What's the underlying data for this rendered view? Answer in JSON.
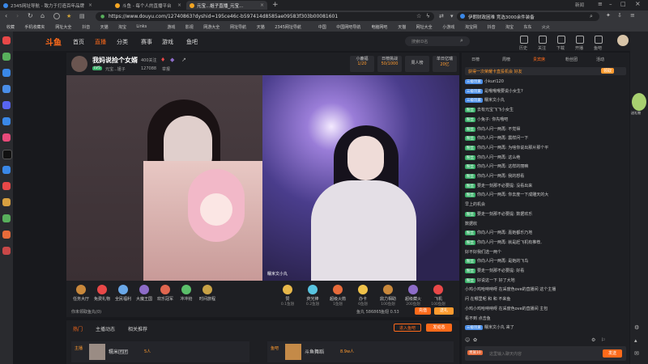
{
  "browser": {
    "tabs": [
      {
        "title": "2345网址导航 - 致力于打造百年品牌",
        "color": "#3a88e8"
      },
      {
        "title": "斗鱼 - 每个人的直播平台",
        "color": "#f5a623"
      },
      {
        "title": "元宝...姐子直播_元宝...",
        "color": "#f5a623"
      }
    ],
    "window_label": "新闻",
    "url": "https://www.douyu.com/12740863?dyshid=195ce46c-b597414d8585ae09583f303b00081601",
    "side_search_text": "伊朗财政困难 竞选3000余件装备",
    "bookmarks": [
      "收藏",
      "手机收藏夹",
      "网址大全",
      "抖音",
      "天猫",
      "淘宝",
      "Links",
      "游戏",
      "影视",
      "网游大全",
      "网址导航",
      "天猫",
      "2345网址导航",
      "中国",
      "中国网吧导航",
      "电脑网吧",
      "天猫",
      "网址大全",
      "小游戏",
      "淘宝网",
      "抖音",
      "淘宝",
      "东东",
      "火火"
    ]
  },
  "site": {
    "logo": "斗鱼",
    "nav": [
      "首页",
      "直播",
      "分类",
      "赛事",
      "游戏",
      "鱼吧"
    ],
    "search_placeholder": "搜索ID名",
    "header_icons": [
      "历史",
      "关注",
      "下载",
      "开播",
      "鱼吧"
    ]
  },
  "room": {
    "title": "我妈说捡个女婿",
    "follows": "400关注",
    "streamer": "元宝...姐子",
    "level": "LV5",
    "room_id": "127088",
    "report": "举报",
    "stats": [
      {
        "label": "小鹿福",
        "value": "1/20"
      },
      {
        "label": "日榜挑战",
        "value": "50/1000"
      },
      {
        "label": "周人榜",
        "value": ""
      },
      {
        "label": "单日亿瑞",
        "value": "20亿"
      }
    ],
    "watermark": "糯米文小丸"
  },
  "gifts_left": [
    {
      "label": "任务大厅",
      "color": "#c9883b"
    },
    {
      "label": "免费礼物",
      "color": "#e94848"
    },
    {
      "label": "全民福利",
      "color": "#6aa8e8"
    },
    {
      "label": "大魔王国",
      "color": "#8d6cc8"
    },
    {
      "label": "欢乐冠军",
      "color": "#e0664f"
    },
    {
      "label": "冲冲抢",
      "color": "#5bbf6a"
    },
    {
      "label": "时间旅程",
      "color": "#c9a246"
    }
  ],
  "gifts_right": [
    {
      "label": "赞",
      "sub": "0.1鱼翅",
      "color": "#e8b84a"
    },
    {
      "label": "荧光棒",
      "sub": "0.2鱼翅",
      "color": "#58c4e0"
    },
    {
      "label": "超级火箭",
      "sub": "1鱼翅",
      "color": "#e86b3a"
    },
    {
      "label": "办卡",
      "sub": "6鱼翅",
      "color": "#f0c24a"
    },
    {
      "label": "鼎力相助",
      "sub": "100鱼翅",
      "color": "#c9883b"
    },
    {
      "label": "超级藏火",
      "sub": "200鱼翅",
      "color": "#8d6cc8"
    },
    {
      "label": "飞机",
      "sub": "100鱼翅",
      "color": "#e94848"
    }
  ],
  "user_bar": {
    "notice": "你未领取鱼丸(0)",
    "fish_balls": "鱼丸 586865",
    "fish_fins": "鱼翅 0.53",
    "btn_recharge": "充值",
    "btn_gift": "送礼"
  },
  "bottom": {
    "tabs": [
      "热门",
      "主播动态",
      "相关推荐"
    ],
    "btn_enter": "进入鱼吧",
    "btn_post": "发动态",
    "cards": [
      {
        "tag": "主播",
        "name": "糯米团团",
        "count": "5人"
      },
      {
        "tag": "鱼吧",
        "name": "斗鱼舞蹈",
        "count": "8.9w人"
      }
    ]
  },
  "chat": {
    "tabs": [
      "日榜",
      "周榜",
      "贵宾席",
      "粉丝团",
      "活动"
    ],
    "banner": "获得一次荣耀卡直投机会 好友",
    "banner_btn": "领取",
    "messages": [
      {
        "badge": "三级玩家",
        "badge_color": "#4a8ee8",
        "text": "小kuri120"
      },
      {
        "badge": "三级玩家",
        "badge_color": "#4a8ee8",
        "text": "是哦哦哦要说小女生?"
      },
      {
        "badge": "三级玩家",
        "badge_color": "#4a8ee8",
        "text": "糯米文小丸"
      },
      {
        "badge": "粉丝",
        "badge_color": "#3ab26a",
        "text": "去有元宝飞飞小女生"
      },
      {
        "badge": "粉丝",
        "badge_color": "#3ab26a",
        "text": "小兔子: 你先哦吧"
      },
      {
        "badge": "粉丝",
        "badge_color": "#3ab26a",
        "text": "你向人问一两再: 不觉得"
      },
      {
        "badge": "粉丝",
        "badge_color": "#3ab26a",
        "text": "你向人问一两再: 震样问一下"
      },
      {
        "badge": "粉丝",
        "badge_color": "#3ab26a",
        "text": "你向人问一两再: 为啥你说出那片那个平"
      },
      {
        "badge": "粉丝",
        "badge_color": "#3ab26a",
        "text": "你向人问一两再: 这么绝"
      },
      {
        "badge": "粉丝",
        "badge_color": "#3ab26a",
        "text": "你向人问一两再: 这样的丽嘛"
      },
      {
        "badge": "粉丝",
        "badge_color": "#3ab26a",
        "text": "你向人问一两再: 我的想看"
      },
      {
        "badge": "粉丝",
        "badge_color": "#3ab26a",
        "text": "要走一刻那不必要提: 没看出来"
      },
      {
        "badge": "粉丝",
        "badge_color": "#3ab26a",
        "text": "你向人问一两再: 你去度一下成雕天的大"
      },
      {
        "badge": "",
        "badge_color": "",
        "text": "早上的机会"
      },
      {
        "badge": "粉丝",
        "badge_color": "#3ab26a",
        "text": "要走一刻那不必要提: 数据欢乐"
      },
      {
        "badge": "",
        "badge_color": "",
        "text": "数据收"
      },
      {
        "badge": "粉丝",
        "badge_color": "#3ab26a",
        "text": "你向人问一两再: 嘉她都乐乃地"
      },
      {
        "badge": "粉丝",
        "badge_color": "#3ab26a",
        "text": "你向人问一两再: 就是赶飞机有推荐,"
      },
      {
        "badge": "",
        "badge_color": "",
        "text": "好不好我们选一两个"
      },
      {
        "badge": "粉丝",
        "badge_color": "#3ab26a",
        "text": "你向人问一两再: 是她的飞鸟"
      },
      {
        "badge": "粉丝",
        "badge_color": "#3ab26a",
        "text": "要走一刻那不必要提: 好看"
      },
      {
        "badge": "粉丝",
        "badge_color": "#3ab26a",
        "text": "好说这一下 好了大地"
      },
      {
        "badge": "",
        "badge_color": "",
        "text": "小鸡小鸡哈呐呐呀 在采度色ove的直播间 这个主播"
      },
      {
        "badge": "",
        "badge_color": "",
        "text": "问 在哪里呢 和 和 不来鱼"
      },
      {
        "badge": "",
        "badge_color": "",
        "text": "小鸡小鸡哈呐呐呀 在采度色ove的直播间 主包"
      },
      {
        "badge": "",
        "badge_color": "",
        "text": "看不到 点击鱼"
      },
      {
        "badge": "三级玩家",
        "badge_color": "#4a8ee8",
        "text": "糯米文小丸 来了"
      }
    ],
    "input_placeholder": "这里输入聊天内容",
    "send_btn": "发送",
    "user_level": "贵族10"
  },
  "right_rail": {
    "promo_label": "送礼物"
  }
}
